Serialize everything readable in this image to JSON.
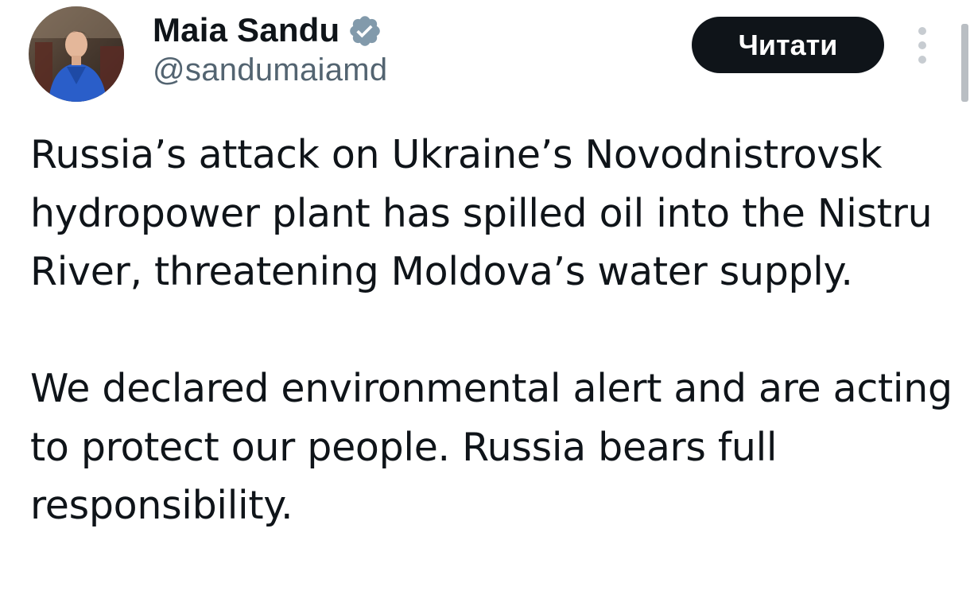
{
  "author": {
    "display_name": "Maia Sandu",
    "handle": "@sandumaiamd",
    "verified": true,
    "verified_color": "#829aab"
  },
  "actions": {
    "follow_label": "Читати",
    "more_icon": "more-vertical-icon"
  },
  "tweet": {
    "paragraphs": [
      "Russia’s attack on Ukraine’s Novodnistrovsk hydropower plant has spilled oil into the Nistru River, threatening Moldova’s water supply.",
      "We declared environmental alert and are acting to protect our people. Russia bears full responsibility."
    ]
  },
  "colors": {
    "text": "#0f1419",
    "secondary_text": "#536471",
    "button_bg": "#0f1419",
    "button_text": "#ffffff"
  }
}
